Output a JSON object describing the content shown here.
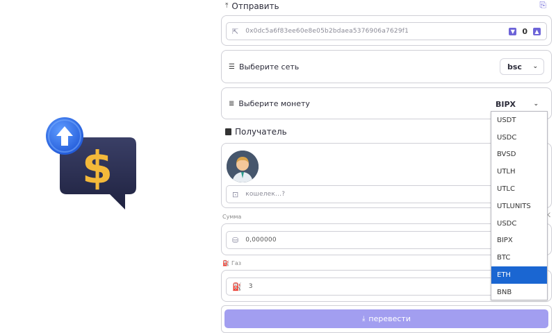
{
  "send": {
    "title": "Отправить",
    "wallet_address": "0x0dc5a6f83ee60e8e05b2bdaea5376906a7629f1",
    "counter": "0"
  },
  "network": {
    "label": "Выберите сеть",
    "selected": "bsc"
  },
  "coin": {
    "label": "Выберите монету",
    "selected": "BIPX",
    "options": [
      "USDT",
      "USDC",
      "BVSD",
      "UTLH",
      "UTLC",
      "UTLUNITS",
      "USDC",
      "BIPX",
      "BTC",
      "ETH",
      "BNB"
    ],
    "highlighted_option": "ETH"
  },
  "recipient": {
    "title": "Получатель",
    "wallet_placeholder": "кошелек...?"
  },
  "amount": {
    "label": "Сумма",
    "value": "0,000000"
  },
  "gas": {
    "label": "Газ",
    "value": "3"
  },
  "actions": {
    "transfer_label": "перевести"
  },
  "colors": {
    "accent": "#6d64d8",
    "button": "#a29ef0",
    "selected_option": "#1a66d2"
  }
}
